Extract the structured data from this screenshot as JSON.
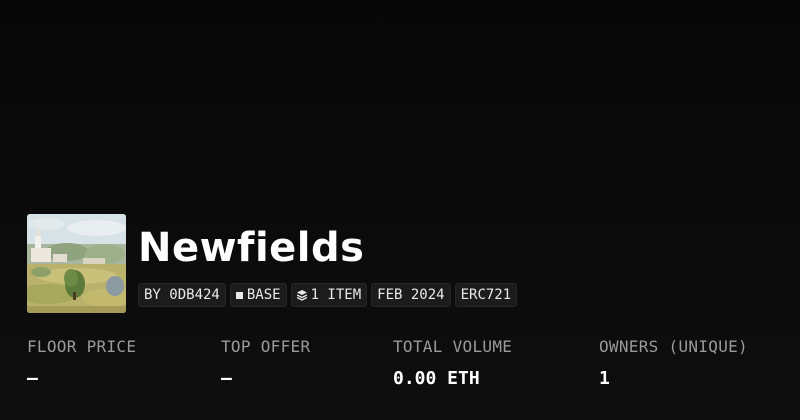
{
  "collection": {
    "name": "Newfields",
    "thumbnail_alt": "painting of village landscape",
    "tags": {
      "creator": "BY 0DB424",
      "chain": "BASE",
      "items": "1 ITEM",
      "date": "FEB 2024",
      "standard": "ERC721"
    }
  },
  "stats": [
    {
      "label": "FLOOR PRICE",
      "value": "—"
    },
    {
      "label": "TOP OFFER",
      "value": "—"
    },
    {
      "label": "TOTAL VOLUME",
      "value": "0.00 ETH"
    },
    {
      "label": "OWNERS (UNIQUE)",
      "value": "1"
    }
  ],
  "colors": {
    "background": "#0b0b0b",
    "tag_bg": "#1c1c1c",
    "label": "#9a9a9a",
    "text": "#ffffff"
  }
}
